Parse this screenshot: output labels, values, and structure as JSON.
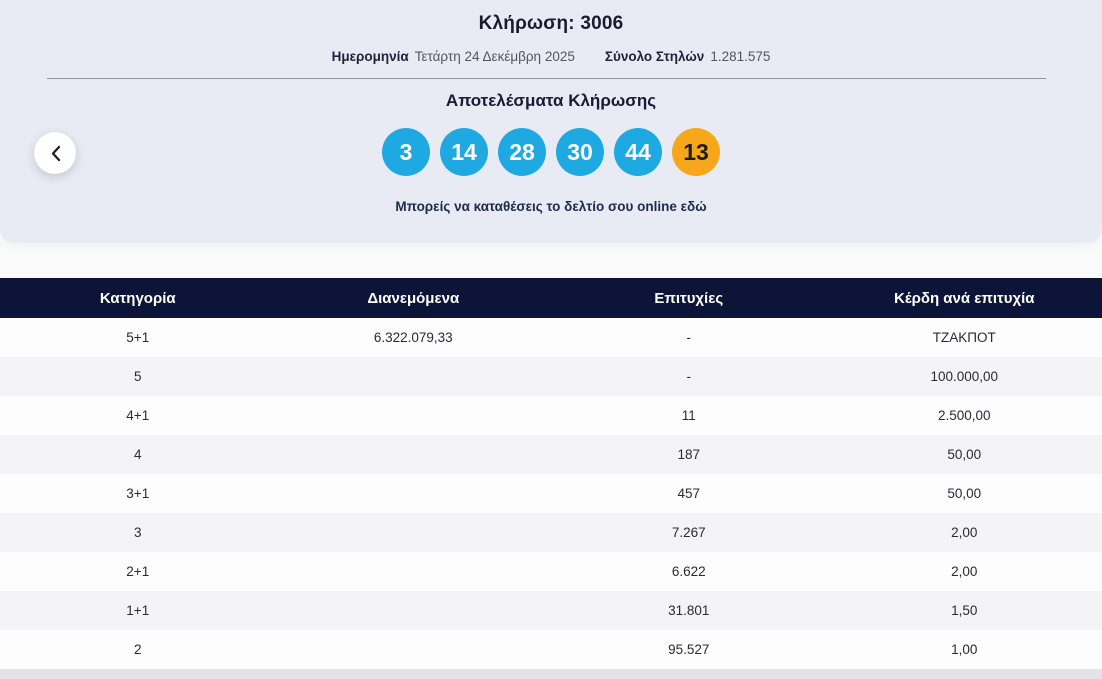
{
  "hero": {
    "title": "Κλήρωση: 3006",
    "date_label": "Ημερομηνία",
    "date_value": "Τετάρτη 24 Δεκέμβρη 2025",
    "total_columns_label": "Σύνολο Στηλών",
    "total_columns_value": "1.281.575",
    "results_heading": "Αποτελέσματα Κλήρωσης",
    "online_text": "Μπορείς να καταθέσεις το δελτίο σου online εδώ"
  },
  "draw": {
    "numbers": [
      "3",
      "14",
      "28",
      "30",
      "44"
    ],
    "joker": "13"
  },
  "table": {
    "headers": [
      "Κατηγορία",
      "Διανεμόμενα",
      "Επιτυχίες",
      "Κέρδη ανά επιτυχία"
    ],
    "rows": [
      {
        "category": "5+1",
        "distributed": "6.322.079,33",
        "winners": "-",
        "prize": "ΤΖΑΚΠΟΤ"
      },
      {
        "category": "5",
        "distributed": "",
        "winners": "-",
        "prize": "100.000,00"
      },
      {
        "category": "4+1",
        "distributed": "",
        "winners": "11",
        "prize": "2.500,00"
      },
      {
        "category": "4",
        "distributed": "",
        "winners": "187",
        "prize": "50,00"
      },
      {
        "category": "3+1",
        "distributed": "",
        "winners": "457",
        "prize": "50,00"
      },
      {
        "category": "3",
        "distributed": "",
        "winners": "7.267",
        "prize": "2,00"
      },
      {
        "category": "2+1",
        "distributed": "",
        "winners": "6.622",
        "prize": "2,00"
      },
      {
        "category": "1+1",
        "distributed": "",
        "winners": "31.801",
        "prize": "1,50"
      },
      {
        "category": "2",
        "distributed": "",
        "winners": "95.527",
        "prize": "1,00"
      }
    ]
  },
  "colors": {
    "ball_blue": "#1FA9E2",
    "ball_orange": "#F8A71B",
    "header_navy": "#0C1538",
    "hero_bg": "#E9EBF4"
  }
}
